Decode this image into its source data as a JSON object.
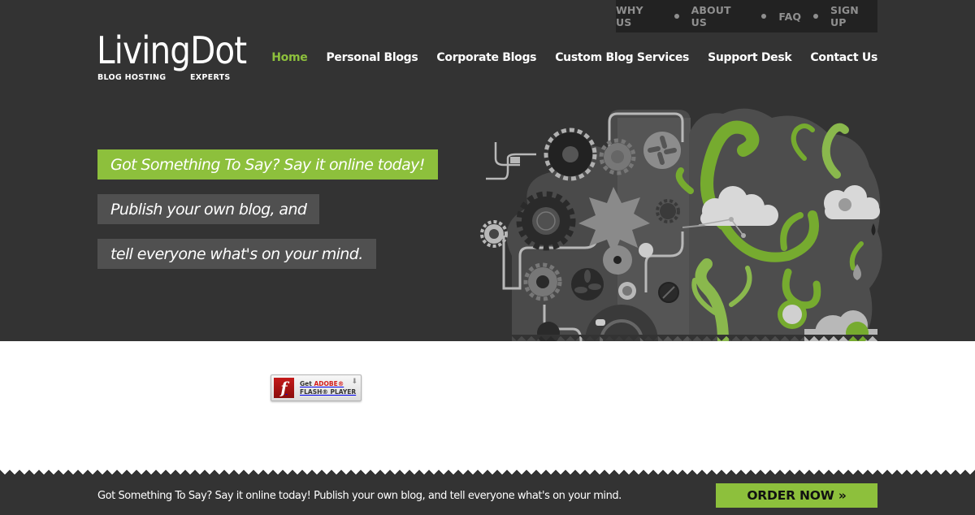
{
  "colors": {
    "background_dark": "#333333",
    "topbar_bg": "#222222",
    "accent_green": "#8dc03c",
    "tagline_gray": "#505050",
    "topbar_text": "#8f8f8f"
  },
  "topbar": {
    "items": [
      {
        "label": "WHY US"
      },
      {
        "label": "ABOUT US"
      },
      {
        "label": "FAQ"
      },
      {
        "label": "SIGN UP"
      }
    ]
  },
  "logo": {
    "name": "LivingDot",
    "tagline_left": "BLOG HOSTING",
    "tagline_right": "EXPERTS"
  },
  "nav": {
    "items": [
      {
        "label": "Home",
        "active": true
      },
      {
        "label": "Personal Blogs"
      },
      {
        "label": "Corporate Blogs"
      },
      {
        "label": "Custom Blog Services"
      },
      {
        "label": "Support Desk"
      },
      {
        "label": "Contact Us"
      }
    ]
  },
  "hero": {
    "lines": [
      "Got Something To Say? Say it online today!",
      "Publish your own blog, and",
      "tell everyone what's on your mind."
    ],
    "illustration": "gears-and-vines-icon"
  },
  "flash_badge": {
    "get": "Get",
    "adobe": "ADOBE®",
    "product": "FLASH® PLAYER",
    "icon": "flash-logo-icon"
  },
  "footer": {
    "text": "Got Something To Say? Say it online today! Publish your own blog, and tell everyone what's on your mind.",
    "order_button": "ORDER NOW »"
  }
}
